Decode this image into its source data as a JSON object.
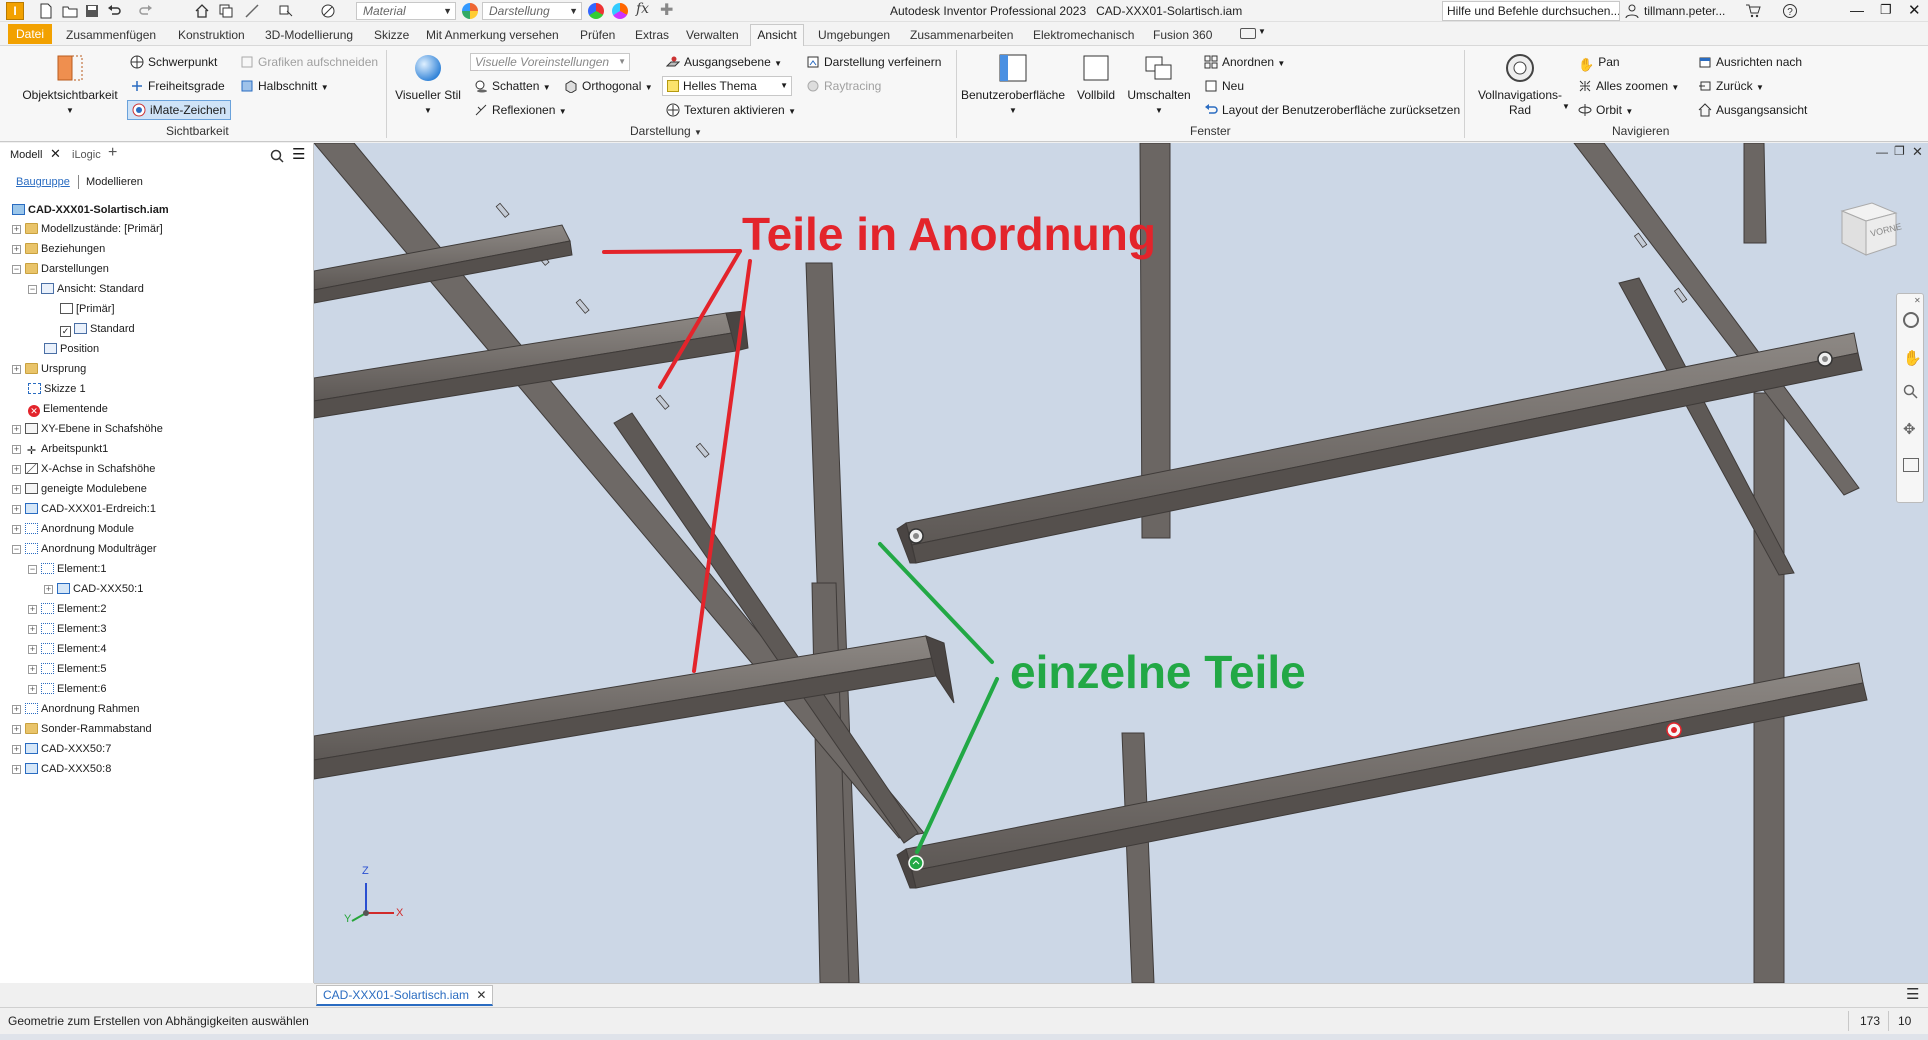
{
  "app": {
    "title": "Autodesk Inventor Professional 2023",
    "file": "CAD-XXX01-Solartisch.iam",
    "help_placeholder": "Hilfe und Befehle durchsuchen...",
    "user": "tillmann.peter...",
    "material": "Material",
    "darstellung": "Darstellung"
  },
  "ribbon_tabs": [
    "Datei",
    "Zusammenfügen",
    "Konstruktion",
    "3D-Modellierung",
    "Skizze",
    "Mit Anmerkung versehen",
    "Prüfen",
    "Extras",
    "Verwalten",
    "Ansicht",
    "Umgebungen",
    "Zusammenarbeiten",
    "Elektromechanisch",
    "Fusion 360"
  ],
  "active_tab": "Ansicht",
  "ribbon": {
    "objektsichtbarkeit": "Objektsichtbarkeit",
    "schwerpunkt": "Schwerpunkt",
    "freiheitsgrade": "Freiheitsgrade",
    "imate": "iMate-Zeichen",
    "grafiken": "Grafiken aufschneiden",
    "halbschnitt": "Halbschnitt",
    "sichtbarkeit": "Sichtbarkeit",
    "visueller_stil": "Visueller Stil",
    "visuelle_voreinst": "Visuelle Voreinstellungen",
    "schatten": "Schatten",
    "orthogonal": "Orthogonal",
    "reflexionen": "Reflexionen",
    "ausgangsebene": "Ausgangsebene",
    "helles_thema": "Helles Thema",
    "texturen": "Texturen aktivieren",
    "verfeinern": "Darstellung verfeinern",
    "raytracing": "Raytracing",
    "darstellung_grp": "Darstellung",
    "benutzeroberflaeche": "Benutzeroberfläche",
    "vollbild": "Vollbild",
    "umschalten": "Umschalten",
    "anordnen": "Anordnen",
    "neu": "Neu",
    "layout_reset": "Layout der Benutzeroberfläche zurücksetzen",
    "fenster": "Fenster",
    "vollnav_1": "Vollnavigations-",
    "vollnav_2": "Rad",
    "pan": "Pan",
    "alles_zoomen": "Alles zoomen",
    "orbit": "Orbit",
    "ausrichten": "Ausrichten nach",
    "zurueck": "Zurück",
    "ausgangsansicht": "Ausgangsansicht",
    "navigieren": "Navigieren"
  },
  "browser": {
    "tab_modell": "Modell",
    "tab_ilogic": "iLogic",
    "sub_baugruppe": "Baugruppe",
    "sub_modellieren": "Modellieren",
    "tree": [
      "CAD-XXX01-Solartisch.iam",
      "Modellzustände: [Primär]",
      "Beziehungen",
      "Darstellungen",
      "Ansicht: Standard",
      "[Primär]",
      "Standard",
      "Position",
      "Ursprung",
      "Skizze 1",
      "Elementende",
      "XY-Ebene in Schafshöhe",
      "Arbeitspunkt1",
      "X-Achse in Schafshöhe",
      "geneigte Modulebene",
      "CAD-XXX01-Erdreich:1",
      "Anordnung Module",
      "Anordnung Modulträger",
      "Element:1",
      "CAD-XXX50:1",
      "Element:2",
      "Element:3",
      "Element:4",
      "Element:5",
      "Element:6",
      "Anordnung Rahmen",
      "Sonder-Rammabstand",
      "CAD-XXX50:7",
      "CAD-XXX50:8"
    ]
  },
  "viewport": {
    "annotation_red": "Teile in Anordnung",
    "annotation_green": "einzelne Teile",
    "viewcube_label": "VORNE",
    "axis_z": "Z",
    "axis_y": "Y",
    "axis_x": "X"
  },
  "doc_tab": "CAD-XXX01-Solartisch.iam",
  "status": {
    "message": "Geometrie zum Erstellen von Abhängigkeiten auswählen",
    "num1": "173",
    "num2": "10"
  },
  "colors": {
    "datei": "#f2a100",
    "viewport_bg": "#ccd7e6",
    "beam": "#6b6663",
    "red": "#e3242b",
    "green": "#22a845"
  }
}
